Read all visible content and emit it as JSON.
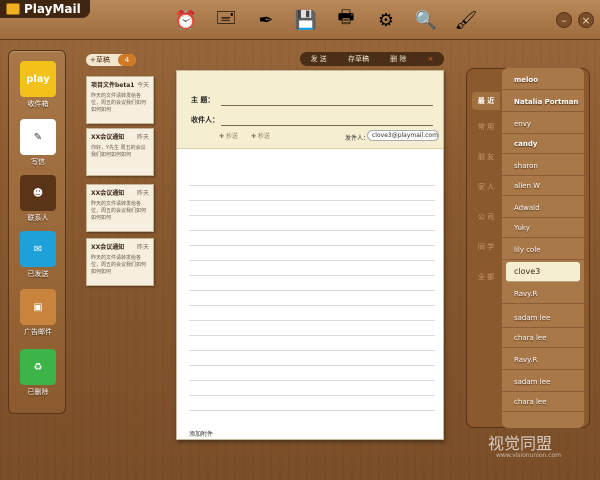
{
  "app": {
    "title": "PlayMail"
  },
  "toolbar": {
    "tools": [
      {
        "icon": "alarm-clock-icon",
        "glyph": "⏰"
      },
      {
        "icon": "stamp-icon",
        "glyph": "🖃"
      },
      {
        "icon": "quill-icon",
        "glyph": "✒"
      },
      {
        "icon": "save-icon",
        "glyph": "💾"
      },
      {
        "icon": "printer-icon",
        "glyph": "🖶"
      },
      {
        "icon": "gear-icon",
        "glyph": "⚙"
      },
      {
        "icon": "search-icon",
        "glyph": "🔍"
      },
      {
        "icon": "brush-icon",
        "glyph": "🖌"
      }
    ],
    "minimize": "–",
    "close": "×"
  },
  "nav": {
    "items": [
      {
        "label": "收件箱",
        "icon": "inbox-icon",
        "text": "play",
        "color": "#f2c21a"
      },
      {
        "label": "写信",
        "icon": "write-icon",
        "text": "✎",
        "color": "#ffffff"
      },
      {
        "label": "联系人",
        "icon": "contacts-icon",
        "text": "☻",
        "color": "#5a3418"
      },
      {
        "label": "已发送",
        "icon": "sent-mailbox-icon",
        "text": "✉",
        "color": "#1ea0d8"
      },
      {
        "label": "广告邮件",
        "icon": "ad-box-icon",
        "text": "▣",
        "color": "#c8843c"
      },
      {
        "label": "已删除",
        "icon": "recycle-bin-icon",
        "text": "♻",
        "color": "#3cb44a"
      }
    ]
  },
  "drafts": {
    "tab_label": "+草稿",
    "count": "4",
    "notes": [
      {
        "title": "项目文件beta1",
        "date": "今天",
        "body": "昨天的文件请转发给各位，周五的会议我们如何如何如何"
      },
      {
        "title": "XX会议通知",
        "date": "昨天",
        "body": "你好，Y先生 周五的会议我们如何如何如何"
      },
      {
        "title": "XX会议通知",
        "date": "昨天",
        "body": "昨天的文件请转发给各位，周五的会议我们如何如何如何"
      },
      {
        "title": "XX会议通知",
        "date": "昨天",
        "body": "昨天的文件请转发给各位，周五的会议我们如何如何如何"
      }
    ]
  },
  "compose": {
    "actions": {
      "send": "发 送",
      "save": "存草稿",
      "delete": "删 除",
      "close": "×"
    },
    "subject_label": "主 题：",
    "to_label": "收件人：",
    "cc_label": "✚ 抄送",
    "bcc_label": "✚ 秒送",
    "sender_label": "发件人：",
    "sender_value": "clove3@playmail.com",
    "attach_label": "添加附件"
  },
  "contacts": {
    "categories": [
      "最 近",
      "常 用",
      "朋 友",
      "家 人",
      "公 司",
      "同 学",
      "全 部"
    ],
    "active_category": 0,
    "list": [
      {
        "name": "meloo",
        "bold": true
      },
      {
        "name": "Natalia Portman",
        "bold": true
      },
      {
        "name": "envy",
        "bold": false
      },
      {
        "name": "candy",
        "bold": true
      },
      {
        "name": "sharon",
        "bold": false
      },
      {
        "name": "allen W",
        "bold": false
      },
      {
        "name": "Adwald",
        "bold": false
      },
      {
        "name": "Yuky",
        "bold": false
      },
      {
        "name": "lily cole",
        "bold": false
      },
      {
        "name": "clove3",
        "bold": false
      },
      {
        "name": "Ravy.R",
        "bold": false
      },
      {
        "name": "sadam lee",
        "bold": false
      },
      {
        "name": "chara lee",
        "bold": false
      },
      {
        "name": "Ravy.R",
        "bold": false
      },
      {
        "name": "sadam lee",
        "bold": false
      },
      {
        "name": "chara lee",
        "bold": false
      }
    ],
    "selected_index": 9
  },
  "watermark": {
    "text": "视觉同盟",
    "sub": "www.visionunion.com"
  }
}
